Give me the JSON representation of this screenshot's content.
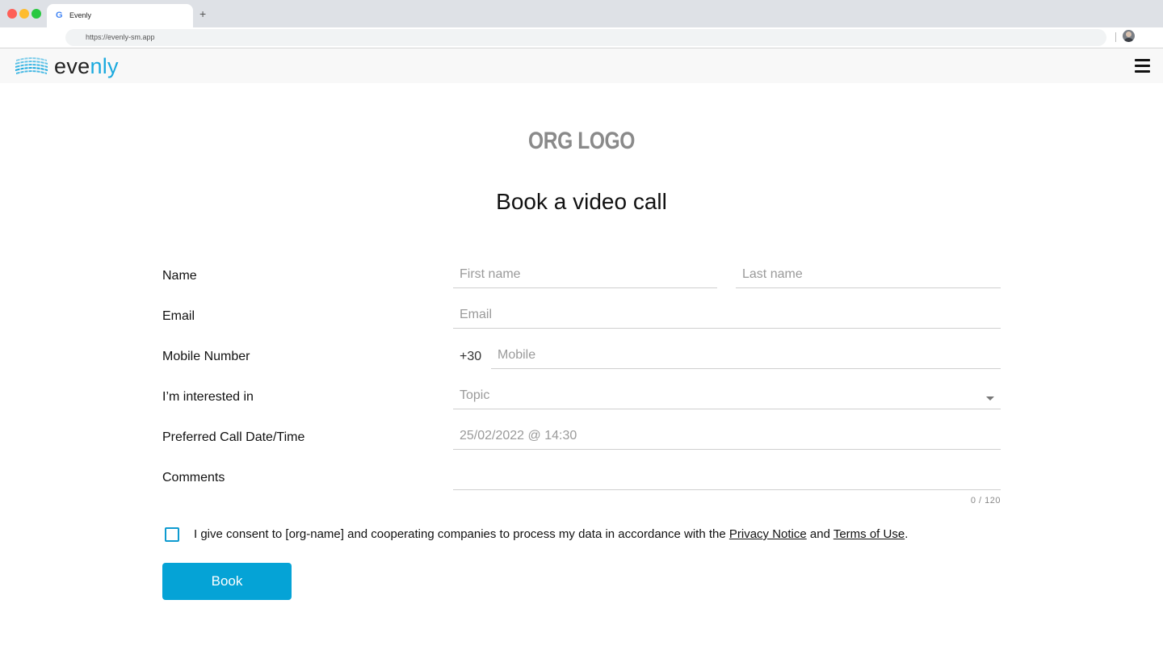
{
  "browser": {
    "tab_title": "Evenly",
    "tab_favicon": "G",
    "new_tab_label": "+",
    "url": "https://evenly-sm.app"
  },
  "header": {
    "brand_prefix": "eve",
    "brand_suffix": "nly",
    "brand_accent_color": "#1aa9de",
    "menu_icon": "hamburger-icon"
  },
  "main": {
    "org_logo": "ORG LOGO",
    "title": "Book a video call"
  },
  "form": {
    "name_label": "Name",
    "first_name_placeholder": "First name",
    "last_name_placeholder": "Last name",
    "email_label": "Email",
    "email_placeholder": "Email",
    "mobile_label": "Mobile Number",
    "mobile_prefix": "+30",
    "mobile_placeholder": "Mobile",
    "interest_label": "I’m interested in",
    "topic_placeholder": "Topic",
    "date_label": "Preferred Call Date/Time",
    "date_placeholder": "25/02/2022 @ 14:30",
    "comments_label": "Comments",
    "comments_count": "0 / 120",
    "consent_text_before": "I give consent to [org-name] and cooperating companies to process my data in accordance with the ",
    "privacy_link": "Privacy Notice",
    "consent_and": " and ",
    "terms_link": "Terms of Use",
    "consent_end": ".",
    "submit_label": "Book",
    "button_color": "#05a3d6"
  }
}
